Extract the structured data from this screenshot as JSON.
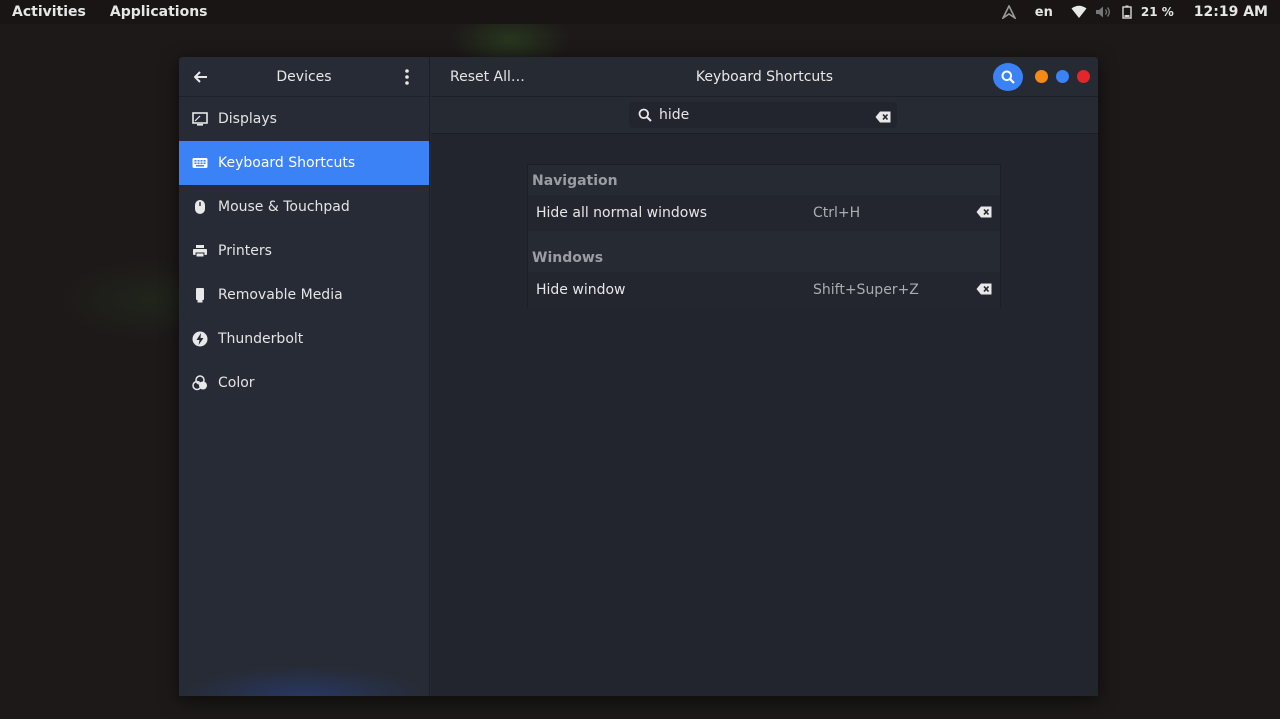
{
  "topbar": {
    "activities": "Activities",
    "applications": "Applications",
    "language": "en",
    "battery": "21 %",
    "clock": "12:19 AM",
    "icons": [
      "app-indicator-icon",
      "wifi-icon",
      "volume-icon",
      "battery-icon"
    ]
  },
  "sidebar": {
    "title": "Devices",
    "items": [
      {
        "label": "Displays",
        "icon": "display-icon"
      },
      {
        "label": "Keyboard Shortcuts",
        "icon": "keyboard-icon",
        "active": true
      },
      {
        "label": "Mouse & Touchpad",
        "icon": "mouse-icon"
      },
      {
        "label": "Printers",
        "icon": "printer-icon"
      },
      {
        "label": "Removable Media",
        "icon": "removable-media-icon"
      },
      {
        "label": "Thunderbolt",
        "icon": "thunderbolt-icon"
      },
      {
        "label": "Color",
        "icon": "color-icon"
      }
    ]
  },
  "header": {
    "reset_label": "Reset All…",
    "title": "Keyboard Shortcuts"
  },
  "search": {
    "value": "hide"
  },
  "shortcuts": {
    "sections": [
      {
        "title": "Navigation",
        "rows": [
          {
            "description": "Hide all normal windows",
            "accel": "Ctrl+H"
          }
        ]
      },
      {
        "title": "Windows",
        "rows": [
          {
            "description": "Hide window",
            "accel": "Shift+Super+Z"
          }
        ]
      }
    ]
  },
  "colors": {
    "accent": "#3a82f6",
    "minimize": "#f58a14",
    "maximize": "#3a82f6",
    "close": "#e5252a"
  }
}
